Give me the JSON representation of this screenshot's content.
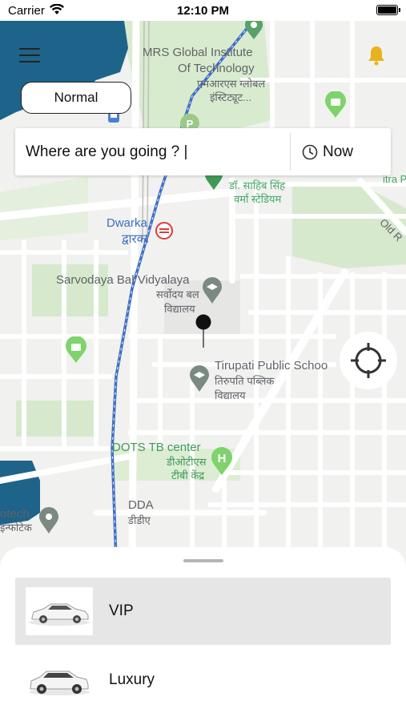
{
  "status_bar": {
    "carrier": "Carrier",
    "time": "12:10 PM"
  },
  "map": {
    "labels": {
      "mrs_en_1": "MRS Global Institute",
      "mrs_en_2": "Of Technology",
      "mrs_hi_1": "एमआरएस ग्लोबल",
      "mrs_hi_2": "इंस्टिट्यूट...",
      "stadium_1": "डॉ. साहिब सिंह",
      "stadium_2": "वर्मा स्टेडियम",
      "mitra_pa": "itra Pa",
      "old_r": "Old R",
      "dwarka_en": "Dwarka",
      "dwarka_hi": "द्वारका",
      "sarvodaya_en": "Sarvodaya Bal Vidyalaya",
      "sarvodaya_hi_1": "सर्वोदय बल",
      "sarvodaya_hi_2": "विद्यालय",
      "tirupati_en": "Tirupati Public Schoo",
      "tirupati_hi_1": "तिरुपति पब्लिक",
      "tirupati_hi_2": "विद्यालय",
      "dots_en": "DOTS TB center",
      "dots_hi_1": "डीओटीएस",
      "dots_hi_2": "टीबी केंद्र",
      "dda_en": "DDA",
      "dda_hi": "डीडीए",
      "infotech_en": "otech",
      "infotech_hi": "इन्फोटेक"
    }
  },
  "mode_pill": {
    "label": "Normal"
  },
  "search": {
    "text": "Where are you going ? |",
    "time_label": "Now"
  },
  "vehicles": [
    {
      "name": "VIP",
      "selected": true
    },
    {
      "name": "Luxury",
      "selected": false
    }
  ],
  "colors": {
    "water": "#1e6389",
    "park_green": "#d6e9cd",
    "rail_blue": "#3f6fc4",
    "bell_gold": "#e8b21a"
  },
  "icons": [
    "wifi-icon",
    "battery-icon",
    "menu-icon",
    "bell-icon",
    "clock-icon",
    "locate-icon",
    "car-icon"
  ]
}
